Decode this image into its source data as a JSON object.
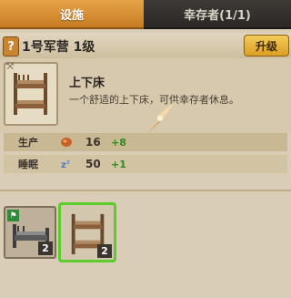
{
  "tabs": [
    {
      "label": "设施"
    },
    {
      "label": "幸存者(1/1)"
    }
  ],
  "header": {
    "help_glyph": "?",
    "title": "1号军营 1级",
    "upgrade_label": "升级"
  },
  "item": {
    "name": "上下床",
    "description": "一个舒适的上下床，可供幸存者休息。",
    "icon": "bunk-bed-icon"
  },
  "stats": [
    {
      "label": "生产",
      "icon": "food-icon",
      "value": "16",
      "delta": "+8"
    },
    {
      "label": "睡眠",
      "icon": "sleep-icon",
      "value": "50",
      "delta": "+1"
    }
  ],
  "inventory": [
    {
      "name": "metal-bed",
      "qty": "2",
      "selected": false
    },
    {
      "name": "bunk-bed",
      "qty": "2",
      "selected": true
    }
  ],
  "colors": {
    "tab_active": "#d48a2e",
    "upgrade": "#e8b33a",
    "delta_green": "#2f8a1f",
    "selection_green": "#5ccc2b"
  }
}
